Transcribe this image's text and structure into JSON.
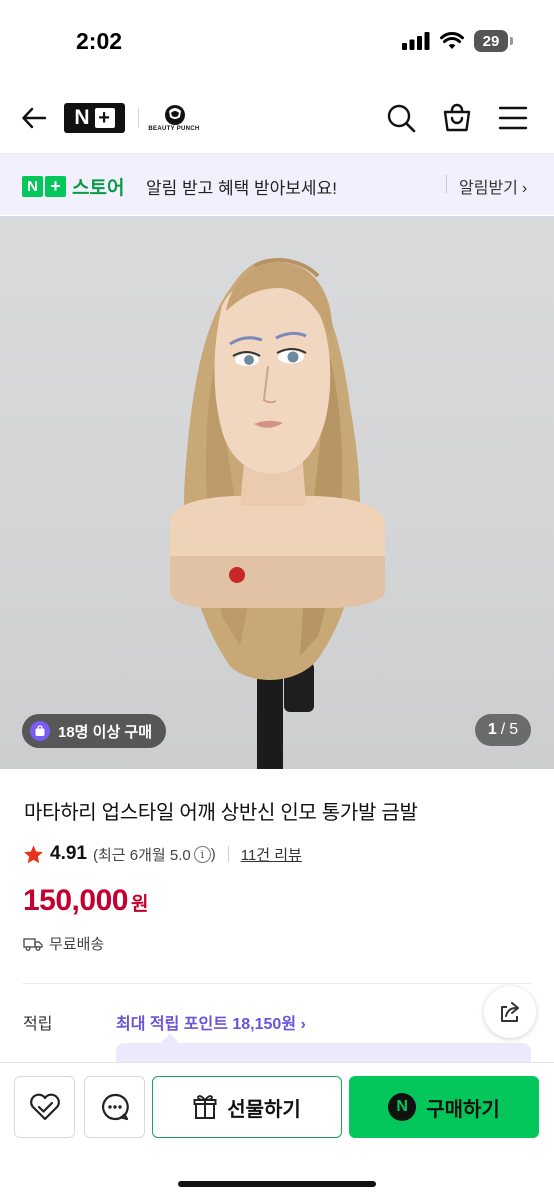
{
  "status_bar": {
    "time": "2:02",
    "battery": "29"
  },
  "header": {
    "logo": "N+",
    "brand_name": "BEAUTY PUNCH",
    "icons": [
      "back-arrow-icon",
      "search-icon",
      "shopping-bag-icon",
      "hamburger-menu-icon"
    ]
  },
  "promo_banner": {
    "store_badge_n": "N",
    "store_badge_plus": "+",
    "store_word": "스토어",
    "message": "알림 받고 혜택 받아보세요!",
    "link_label": "알림받기",
    "link_chevron": "›"
  },
  "gallery": {
    "buyer_badge": "18명 이상 구매",
    "current_page": "1",
    "separator": "/",
    "total_pages": "5"
  },
  "product": {
    "title": "마타하리 업스타일 어깨 상반신 인모 통가발 금발",
    "rating": "4.91",
    "recent_rating": "(최근 6개월 5.0",
    "recent_close": ")",
    "info_symbol": "i",
    "review_count": "11건 리뷰",
    "price": "150,000",
    "currency": "원",
    "shipping": "무료배송",
    "points_label": "적립",
    "points_value": "최대 적립 포인트 18,150원 ›"
  },
  "bottom_bar": {
    "gift_label": "선물하기",
    "buy_label": "구매하기",
    "buy_badge": "N"
  },
  "colors": {
    "price_red": "#c4002e",
    "naver_green": "#03c75a",
    "points_purple": "#6a54d9",
    "banner_bg": "#f2f0fd"
  }
}
